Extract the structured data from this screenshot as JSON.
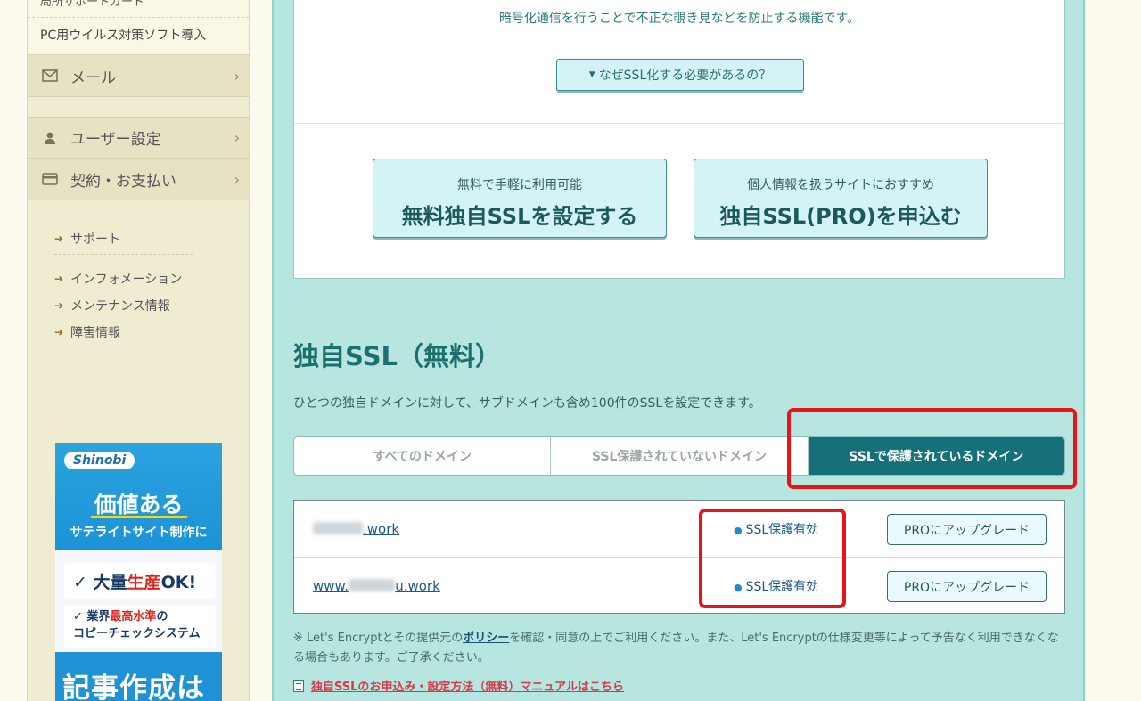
{
  "sidebar": {
    "top_partial": "局所サポートガード",
    "sub_item": "PC用ウイルス対策ソフト導入",
    "categories": [
      {
        "label": "メール",
        "icon": "envelope-icon"
      },
      {
        "label": "ユーザー設定",
        "icon": "user-icon"
      },
      {
        "label": "契約・お支払い",
        "icon": "credit-card-icon"
      }
    ],
    "chevron": "›",
    "link_arrow": "➔",
    "links_group1": [
      "サポート"
    ],
    "links_group2": [
      "インフォメーション",
      "メンテナンス情報",
      "障害情報"
    ]
  },
  "banner": {
    "logo": "Shinobi",
    "title": "価値ある",
    "subtitle": "サテライトサイト制作に",
    "card1_prefix": "✓ 大量",
    "card1_red": "生産",
    "card1_suffix": "OK!",
    "card2_line1_prefix": "✓ 業界",
    "card2_line1_red": "最高水準",
    "card2_line1_suffix": "の",
    "card2_line2": "コピーチェックシステム",
    "big_text": "記事作成は"
  },
  "panel": {
    "description": "暗号化通信を行うことで不正な覗き見などを防止する機能です。",
    "why_button_label": "なぜSSL化する必要があるの？",
    "why_button_icon": "▼",
    "free_button_small": "無料で手軽に利用可能",
    "free_button_big": "無料独自SSLを設定する",
    "pro_button_small": "個人情報を扱うサイトにおすすめ",
    "pro_button_big": "独自SSL(PRO)を申込む"
  },
  "section": {
    "title": "独自SSL（無料）",
    "description": "ひとつの独自ドメインに対して、サブドメインも含め100件のSSLを設定できます。"
  },
  "tabs": [
    {
      "label": "すべてのドメイン",
      "active": false
    },
    {
      "label": "SSL保護されていないドメイン",
      "active": false
    },
    {
      "label": "SSLで保護されているドメイン",
      "active": true
    }
  ],
  "rows": [
    {
      "domain_prefix": "",
      "domain_suffix": ".work",
      "status": "SSL保護有効",
      "action": "PROにアップグレード"
    },
    {
      "domain_prefix": "www.",
      "domain_suffix": "u.work",
      "status": "SSL保護有効",
      "action": "PROにアップグレード"
    }
  ],
  "note": {
    "part1": "※ Let's Encryptとその提供元の",
    "policy_link": "ポリシー",
    "part2": "を確認・同意の上でご利用ください。また、Let's Encryptの仕様変更等によって予告なく利用できなくなる場合もあります。ご了承ください。"
  },
  "manual_link": "独自SSLのお申込み・設定方法（無料）マニュアルはこちら",
  "colors": {
    "accent": "#16707a",
    "highlight": "#e8141a",
    "main_bg": "#b7e6e1",
    "sidebar_bg": "#f0ecd2"
  }
}
